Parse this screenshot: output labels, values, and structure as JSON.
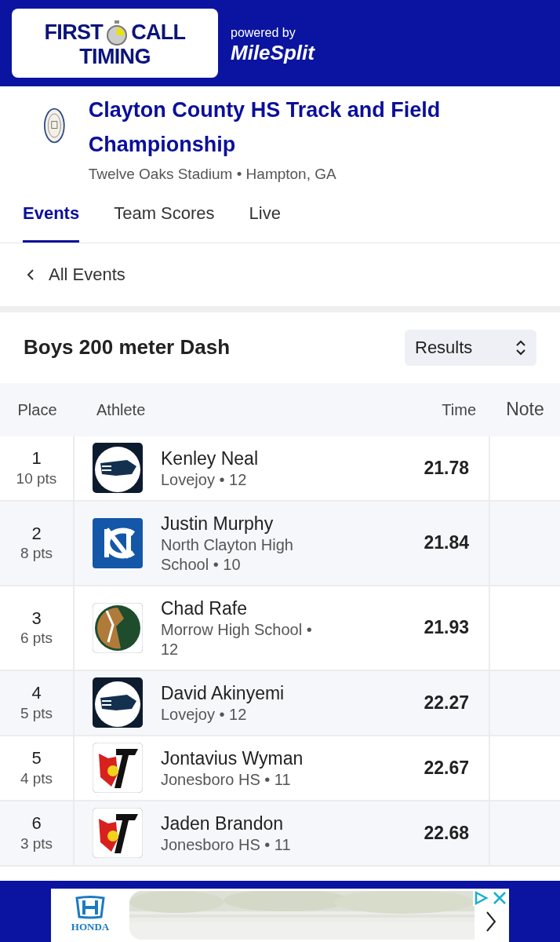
{
  "header": {
    "logo_lines": [
      "FIRST",
      "CALL",
      "TIMING"
    ],
    "powered_by": "powered by",
    "brand": "MileSplit"
  },
  "meet": {
    "title": "Clayton County HS Track and Field Championship",
    "venue": "Twelve Oaks Stadium • Hampton, GA"
  },
  "tabs": [
    {
      "label": "Events",
      "selected": true
    },
    {
      "label": "Team Scores",
      "selected": false
    },
    {
      "label": "Live",
      "selected": false
    }
  ],
  "back_link": "All Events",
  "event": {
    "title": "Boys 200 meter Dash",
    "view_select": "Results"
  },
  "table": {
    "columns": [
      "Place",
      "Athlete",
      "Time",
      "Note"
    ],
    "rows": [
      {
        "place": "1",
        "points": "10 pts",
        "kind": "panther",
        "name": "Kenley Neal",
        "school": "Lovejoy • 12",
        "time": "21.78"
      },
      {
        "place": "2",
        "points": "8 pts",
        "kind": "monogram",
        "name": "Justin Murphy",
        "school": "North Clayton High School • 10",
        "time": "21.84"
      },
      {
        "place": "3",
        "points": "6 pts",
        "kind": "horse",
        "name": "Chad Rafe",
        "school": "Morrow High School • 12",
        "time": "21.93"
      },
      {
        "place": "4",
        "points": "5 pts",
        "kind": "panther",
        "name": "David Akinyemi",
        "school": "Lovejoy • 12",
        "time": "22.27"
      },
      {
        "place": "5",
        "points": "4 pts",
        "kind": "cardinal",
        "name": "Jontavius Wyman",
        "school": "Jonesboro HS • 11",
        "time": "22.67"
      },
      {
        "place": "6",
        "points": "3 pts",
        "kind": "cardinal",
        "name": "Jaden Brandon",
        "school": "Jonesboro HS • 11",
        "time": "22.68"
      }
    ]
  },
  "ad": {
    "brand": "HONDA"
  }
}
